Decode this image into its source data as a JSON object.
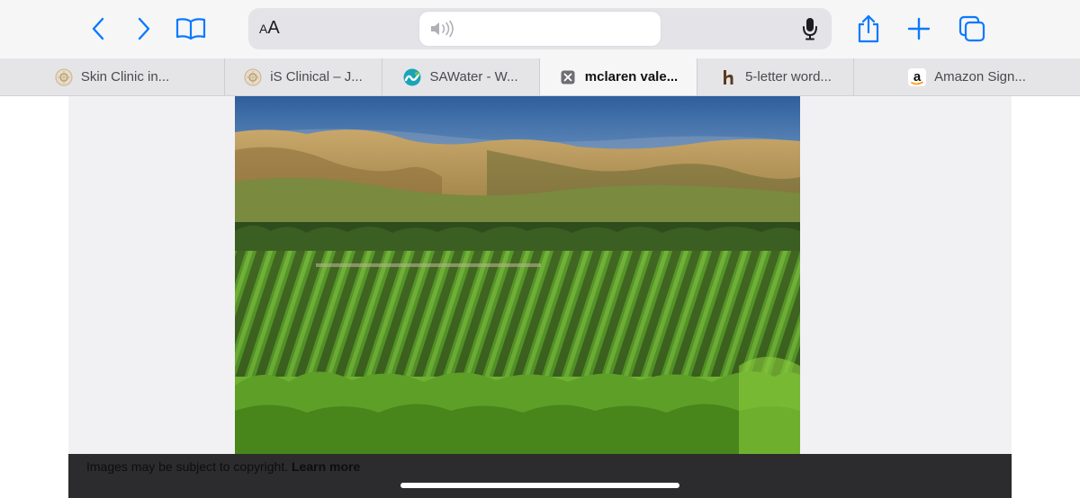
{
  "colors": {
    "accent": "#0a7aff",
    "toolbar_bg": "#f6f6f7",
    "tabbar_bg": "#e5e5e8",
    "content_bg": "#f1f1f3",
    "bottom_bar": "#2c2c2e"
  },
  "toolbar": {
    "back_icon": "chevron-left-icon",
    "forward_icon": "chevron-right-icon",
    "bookmarks_icon": "book-icon",
    "reader_label_small": "A",
    "reader_label_big": "A",
    "audio_icon": "speaker-icon",
    "mic_icon": "microphone-icon",
    "share_icon": "share-icon",
    "new_tab_icon": "plus-icon",
    "tabs_icon": "tabs-overview-icon"
  },
  "tabs": [
    {
      "label": "Skin Clinic in...",
      "icon": "clinic-favicon"
    },
    {
      "label": "iS Clinical – J...",
      "icon": "clinic-favicon"
    },
    {
      "label": "SAWater - W...",
      "icon": "sawater-favicon"
    },
    {
      "label": "mclaren vale...",
      "icon": "close-icon",
      "active": true
    },
    {
      "label": "5-letter word...",
      "icon": "h-favicon"
    },
    {
      "label": "Amazon Sign...",
      "icon": "amazon-favicon"
    }
  ],
  "image_viewer": {
    "copyright_text": "Images may be subject to copyright.",
    "learn_more": "Learn more"
  }
}
